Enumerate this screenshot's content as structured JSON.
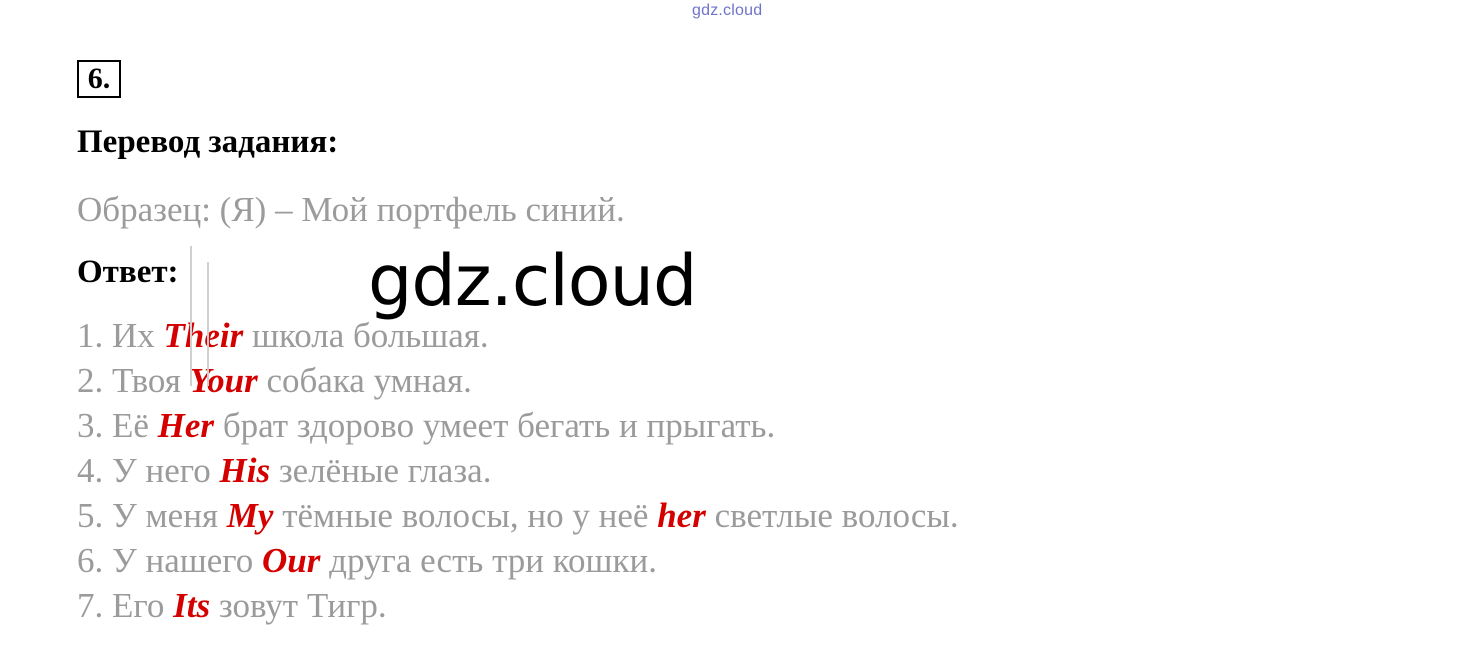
{
  "watermark_top": "gdz.cloud",
  "watermark_center": "gdz.cloud",
  "task_number": "6.",
  "heading": "Перевод задания:",
  "sample": "Образец: (Я) – Мой портфель синий.",
  "answer_label": "Ответ:",
  "sentences": [
    {
      "num": "1.",
      "before": "Их",
      "answer": "Their",
      "after": "школа большая."
    },
    {
      "num": "2.",
      "before": "Твоя",
      "answer": "Your",
      "after": "собака умная."
    },
    {
      "num": "3.",
      "before": "Её",
      "answer": "Her",
      "after": "брат здорово умеет бегать и прыгать."
    },
    {
      "num": "4.",
      "before": "У него",
      "answer": "His",
      "after": "зелёные глаза."
    },
    {
      "num": "5.",
      "before": "У меня",
      "answer": "My",
      "after": "тёмные волосы, но у неё",
      "answer2": "her",
      "after2": "светлые волосы."
    },
    {
      "num": "6.",
      "before": "У нашего",
      "answer": "Our",
      "after": "друга есть три кошки."
    },
    {
      "num": "7.",
      "before": "Его",
      "answer": "Its",
      "after": "зовут Тигр."
    }
  ],
  "colors": {
    "answer": "#d40000",
    "text": "#9b9b9b",
    "watermark_top": "#6f73c9"
  }
}
